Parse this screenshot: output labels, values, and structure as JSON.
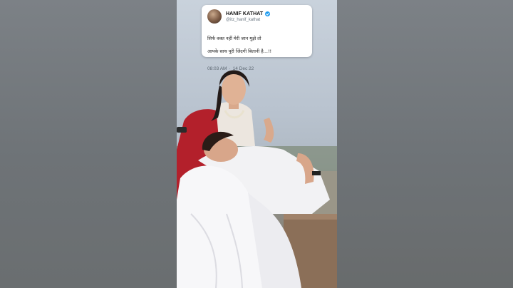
{
  "tweet": {
    "display_name": "HANIF KATHAT",
    "handle": "@itz_hanif_kathat",
    "text_line1": "सिर्फ वक्त नहीं मेरी जान मुझे तो",
    "text_line2": "आपके साथ पूरी जिंदगी बितानी है...!!",
    "time": "08:03 AM",
    "separator": "·",
    "date": "14 Dec 22",
    "verified_color": "#1d9bf0"
  },
  "icons": {
    "verified": "verified-badge-icon",
    "avatar": "profile-avatar"
  }
}
